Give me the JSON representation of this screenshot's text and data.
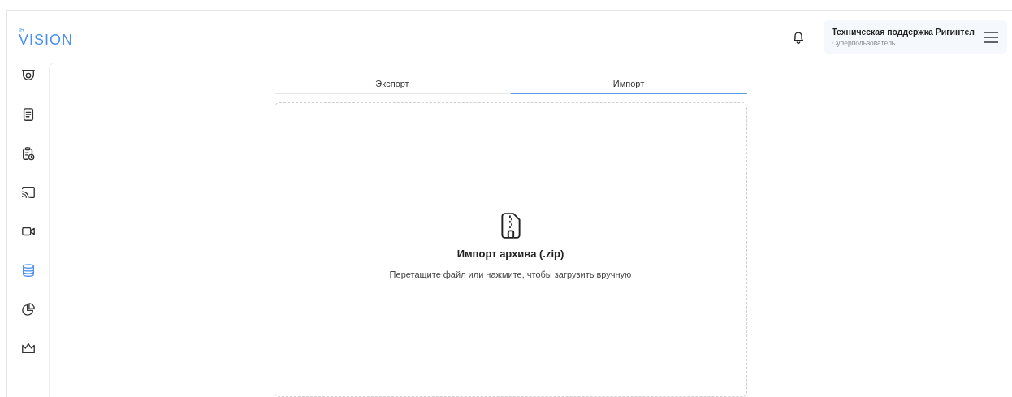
{
  "logo": {
    "superscript": "IR",
    "name": "VISION"
  },
  "sidebar": {
    "items": [
      {
        "kind": "camera",
        "selected": false
      },
      {
        "kind": "document",
        "selected": false
      },
      {
        "kind": "clipboard-clock",
        "selected": false
      },
      {
        "kind": "cast",
        "selected": false
      },
      {
        "kind": "video",
        "selected": false
      },
      {
        "kind": "database",
        "selected": true
      },
      {
        "kind": "pie",
        "selected": false
      },
      {
        "kind": "crown",
        "selected": false
      }
    ]
  },
  "user": {
    "name": "Техническая поддержка Ригинтел",
    "role": "Суперпользователь"
  },
  "tabs": [
    {
      "label": "Экспорт",
      "selected": false
    },
    {
      "label": "Импорт",
      "selected": true
    }
  ],
  "dropzone": {
    "title": "Импорт архива (.zip)",
    "hint": "Перетащите файл или нажмите, чтобы загрузить вручную"
  }
}
